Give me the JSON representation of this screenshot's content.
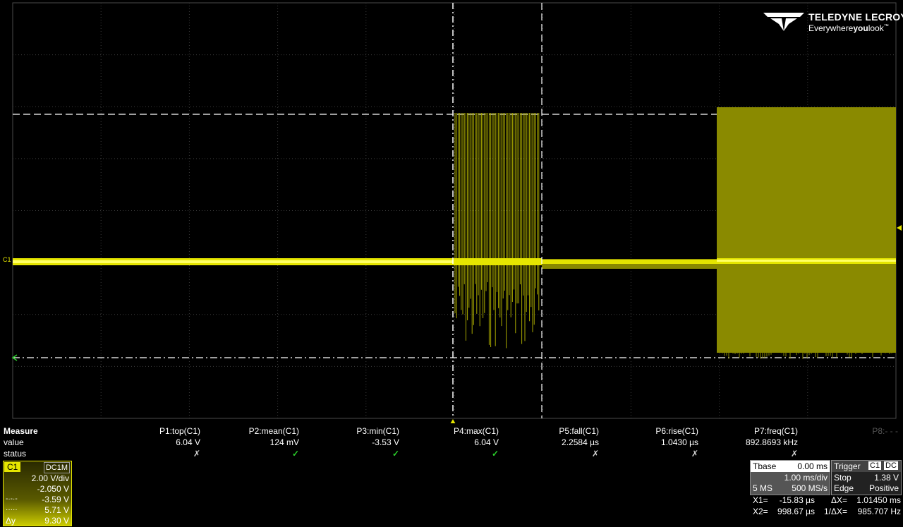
{
  "brand": {
    "name": "TELEDYNE LECROY",
    "tagline_pre": "Everywhere",
    "tagline_bold": "you",
    "tagline_post": "look",
    "tm": "™"
  },
  "channel_marker": "C1",
  "measure": {
    "header": "Measure",
    "row_value": "value",
    "row_status": "status",
    "params": [
      {
        "name": "P1:top(C1)",
        "value": "6.04 V",
        "status": "✗"
      },
      {
        "name": "P2:mean(C1)",
        "value": "124 mV",
        "status": "✓"
      },
      {
        "name": "P3:min(C1)",
        "value": "-3.53 V",
        "status": "✓"
      },
      {
        "name": "P4:max(C1)",
        "value": "6.04 V",
        "status": "✓"
      },
      {
        "name": "P5:fall(C1)",
        "value": "2.2584 µs",
        "status": "✗"
      },
      {
        "name": "P6:rise(C1)",
        "value": "1.0430 µs",
        "status": "✗"
      },
      {
        "name": "P7:freq(C1)",
        "value": "892.8693 kHz",
        "status": "✗"
      }
    ],
    "p8": "P8:- - -"
  },
  "channel": {
    "name": "C1",
    "coupling": "DC1M",
    "vdiv": "2.00 V/div",
    "offset": "-2.050 V",
    "cursor1_label": "-·-·-",
    "cursor1": "-3.59 V",
    "cursor2_label": "·····",
    "cursor2": "5.71 V",
    "delta_label": "Δy",
    "delta": "9.30 V"
  },
  "timebase": {
    "title": "Tbase",
    "delay": "0.00 ms",
    "tdiv": "1.00 ms/div",
    "samples": "5 MS",
    "rate": "500 MS/s"
  },
  "trigger": {
    "title": "Trigger",
    "source": "C1",
    "coupling": "DC",
    "mode": "Stop",
    "level": "1.38 V",
    "type": "Edge",
    "slope": "Positive"
  },
  "cursors": {
    "x1_label": "X1=",
    "x1": "-15.83 µs",
    "dx_label": "ΔX=",
    "dx": "1.01450 ms",
    "x2_label": "X2=",
    "x2": "998.67 µs",
    "inv_label": "1/ΔX=",
    "inv": "985.707 Hz"
  },
  "colors": {
    "trace": "#ffff00",
    "trace_fill": "#8a8a00",
    "grid": "#4a4a4a",
    "ok": "#2bd12b"
  }
}
